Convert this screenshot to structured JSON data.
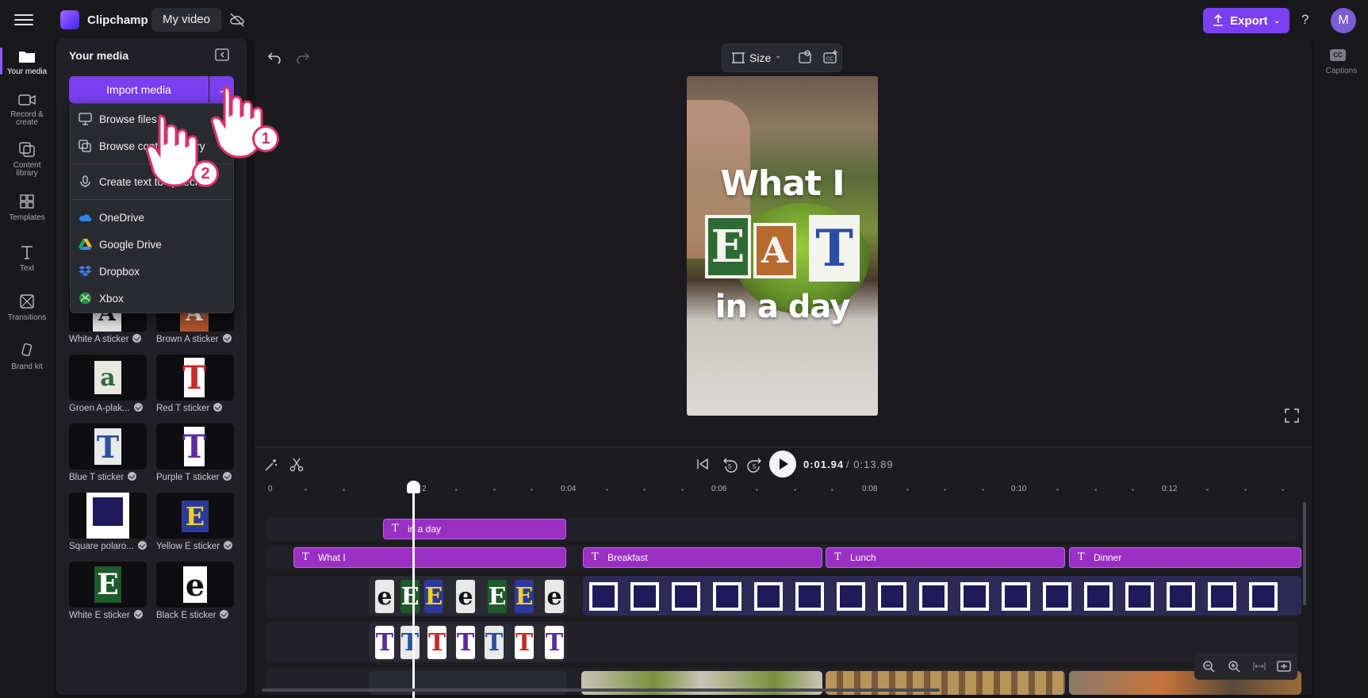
{
  "header": {
    "app_name": "Clipchamp",
    "project_name": "My video",
    "export_label": "Export",
    "help_label": "?",
    "avatar_initial": "M"
  },
  "rail": {
    "items": [
      {
        "label": "Your media"
      },
      {
        "label": "Record &"
      },
      {
        "label": "create"
      },
      {
        "label": "Content"
      },
      {
        "label": "library"
      },
      {
        "label": "Templates"
      },
      {
        "label": "Text"
      },
      {
        "label": "Transitions"
      },
      {
        "label": "Brand kit"
      }
    ],
    "captions_label": "Captions"
  },
  "media": {
    "title": "Your media",
    "import_label": "Import media",
    "dropdown": [
      {
        "label": "Browse files",
        "icon": "monitor-icon"
      },
      {
        "label": "Browse content library",
        "icon": "library-icon"
      },
      {
        "label": "Create text to speech",
        "icon": "microphone-icon"
      },
      {
        "label": "OneDrive",
        "icon": "onedrive-icon"
      },
      {
        "label": "Google Drive",
        "icon": "google-drive-icon"
      },
      {
        "label": "Dropbox",
        "icon": "dropbox-icon"
      },
      {
        "label": "Xbox",
        "icon": "xbox-icon"
      }
    ],
    "stickers": [
      {
        "label": "White A sticker",
        "glyph": "A"
      },
      {
        "label": "Brown A sticker",
        "glyph": "A"
      },
      {
        "label": "Groen A-plak...",
        "glyph": "a"
      },
      {
        "label": "Red T sticker",
        "glyph": "T"
      },
      {
        "label": "Blue T sticker",
        "glyph": "T"
      },
      {
        "label": "Purple T sticker",
        "glyph": "T"
      },
      {
        "label": "Square polaro...",
        "glyph": ""
      },
      {
        "label": "Yellow E sticker",
        "glyph": "E"
      },
      {
        "label": "White E sticker",
        "glyph": "E"
      },
      {
        "label": "Black E sticker",
        "glyph": "e"
      }
    ]
  },
  "callouts": {
    "one": "1",
    "two": "2"
  },
  "preview": {
    "size_label": "Size",
    "overlay_line1": "What I",
    "overlay_letters": [
      "E",
      "A",
      "T"
    ],
    "overlay_line3": "in a day"
  },
  "playback": {
    "current_time": "0:01.94",
    "total_time": "/ 0:13.89",
    "skip_back": "5",
    "skip_forward": "5"
  },
  "ruler": [
    "0",
    "2",
    "0:04",
    "0:06",
    "0:08",
    "0:10",
    "0:12"
  ],
  "tracks": {
    "top_text": "in a day",
    "text_clips": [
      "What I",
      "Breakfast",
      "Lunch",
      "Dinner"
    ]
  },
  "colors": {
    "accent": "#7b3ff2",
    "text_clip": "#9a2fc4",
    "panel": "#202026"
  }
}
